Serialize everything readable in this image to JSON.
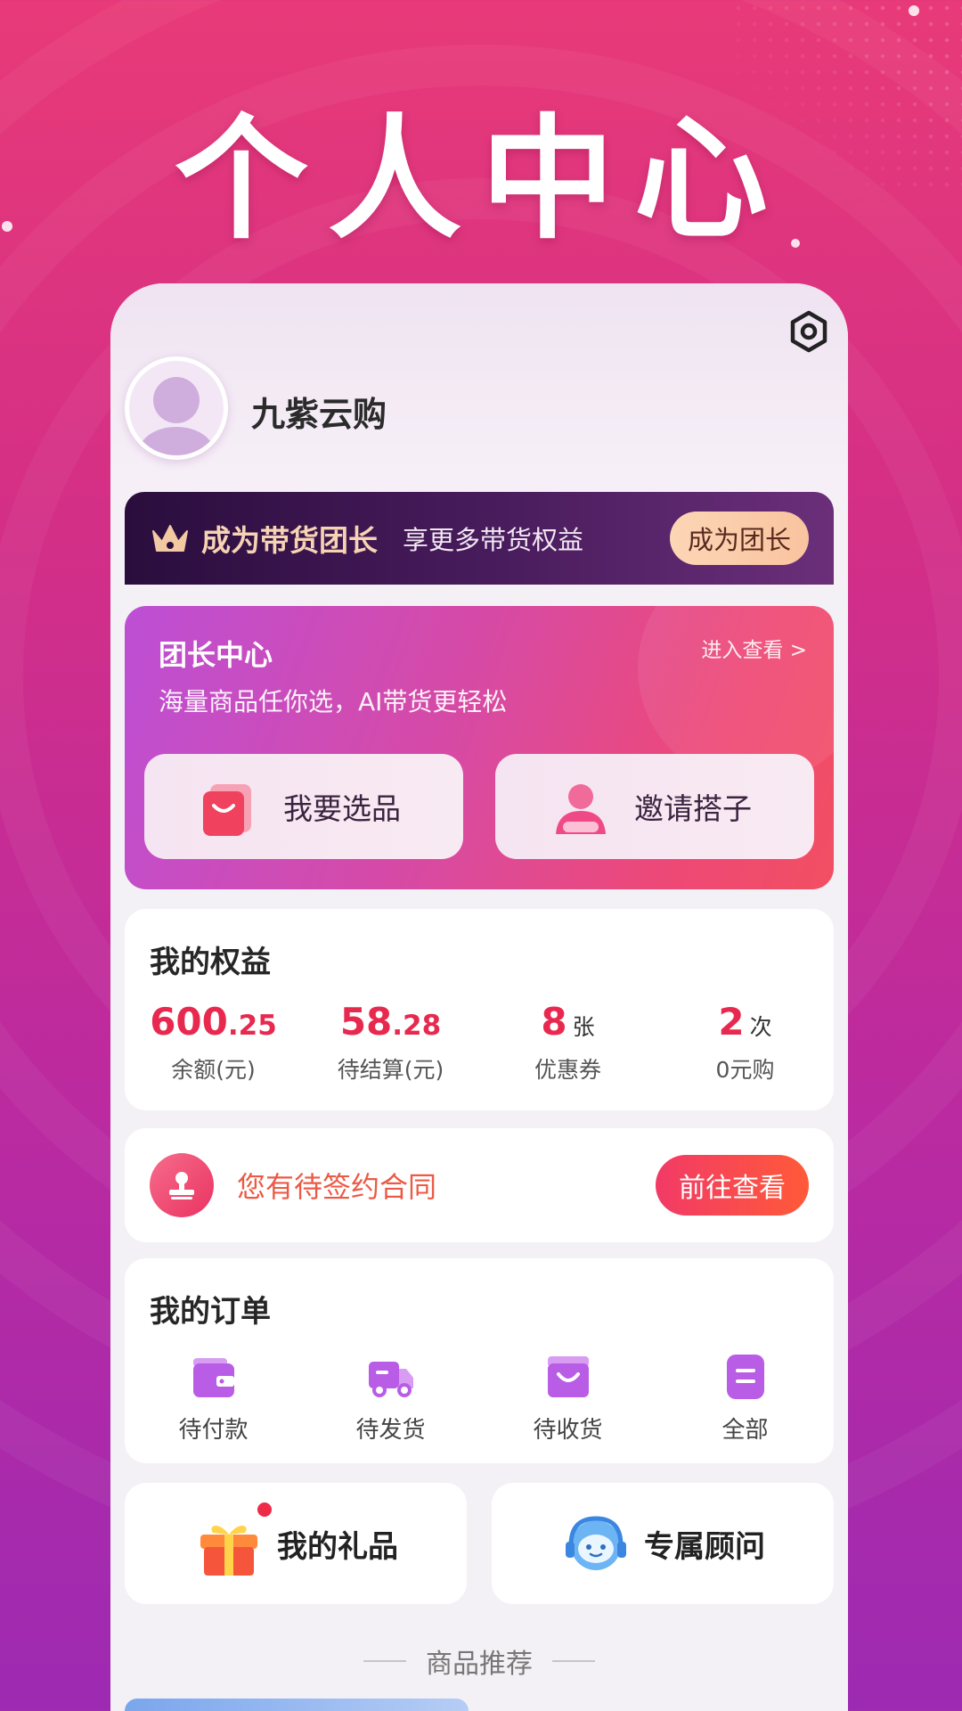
{
  "hero": {
    "title": "个人中心"
  },
  "profile": {
    "username": "九紫云购"
  },
  "leader_banner": {
    "title": "成为带货团长",
    "subtitle": "享更多带货权益",
    "button": "成为团长"
  },
  "leader_center": {
    "title": "团长中心",
    "subtitle": "海量商品任你选，AI带货更轻松",
    "link": "进入查看 >",
    "buttons": [
      {
        "label": "我要选品",
        "icon": "shopping-bag-icon"
      },
      {
        "label": "邀请搭子",
        "icon": "person-icon"
      }
    ]
  },
  "rights": {
    "title": "我的权益",
    "items": [
      {
        "int": "600",
        "dec": ".25",
        "unit": "",
        "label": "余额(元)"
      },
      {
        "int": "58",
        "dec": ".28",
        "unit": "",
        "label": "待结算(元)"
      },
      {
        "int": "8",
        "dec": "",
        "unit": "张",
        "label": "优惠券"
      },
      {
        "int": "2",
        "dec": "",
        "unit": "次",
        "label": "0元购"
      }
    ]
  },
  "contract": {
    "text": "您有待签约合同",
    "button": "前往查看",
    "icon": "stamp-icon"
  },
  "orders": {
    "title": "我的订单",
    "items": [
      {
        "label": "待付款",
        "icon": "wallet-icon"
      },
      {
        "label": "待发货",
        "icon": "truck-icon"
      },
      {
        "label": "待收货",
        "icon": "bag-icon"
      },
      {
        "label": "全部",
        "icon": "list-icon"
      }
    ]
  },
  "quick": {
    "gift": {
      "label": "我的礼品",
      "icon": "gift-icon"
    },
    "advisor": {
      "label": "专属顾问",
      "icon": "headset-robot-icon"
    }
  },
  "recommend": {
    "title": "商品推荐"
  },
  "colors": {
    "accent_red": "#e8294f",
    "banner_gold": "#f6d3b3",
    "order_icon_purple": "#b95ce6"
  }
}
